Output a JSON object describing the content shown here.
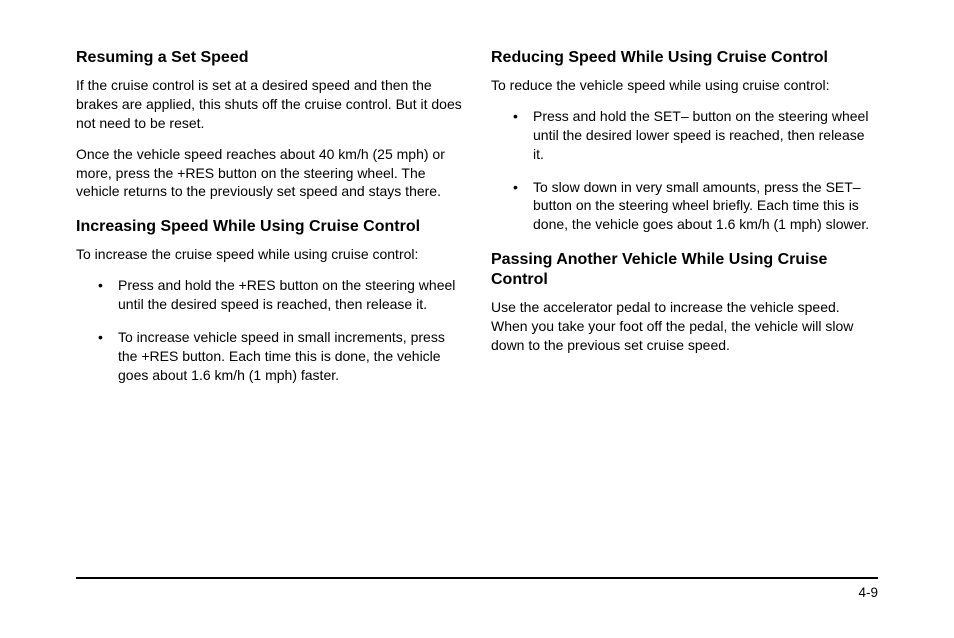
{
  "left": {
    "section1": {
      "heading": "Resuming a Set Speed",
      "p1": "If the cruise control is set at a desired speed and then the brakes are applied, this shuts off the cruise control. But it does not need to be reset.",
      "p2": "Once the vehicle speed reaches about 40 km/h (25 mph) or more, press the +RES button on the steering wheel. The vehicle returns to the previously set speed and stays there."
    },
    "section2": {
      "heading": "Increasing Speed While Using Cruise Control",
      "intro": "To increase the cruise speed while using cruise control:",
      "bullets": [
        "Press and hold the +RES button on the steering wheel until the desired speed is reached, then release it.",
        "To increase vehicle speed in small increments, press the +RES button. Each time this is done, the vehicle goes about 1.6 km/h (1 mph) faster."
      ]
    }
  },
  "right": {
    "section1": {
      "heading": "Reducing Speed While Using Cruise Control",
      "intro": "To reduce the vehicle speed while using cruise control:",
      "bullets": [
        "Press and hold the SET– button on the steering wheel until the desired lower speed is reached, then release it.",
        "To slow down in very small amounts, press the SET– button on the steering wheel briefly. Each time this is done, the vehicle goes about 1.6 km/h (1 mph) slower."
      ]
    },
    "section2": {
      "heading": "Passing Another Vehicle While Using Cruise Control",
      "p1": "Use the accelerator pedal to increase the vehicle speed. When you take your foot off the pedal, the vehicle will slow down to the previous set cruise speed."
    }
  },
  "page_number": "4-9"
}
